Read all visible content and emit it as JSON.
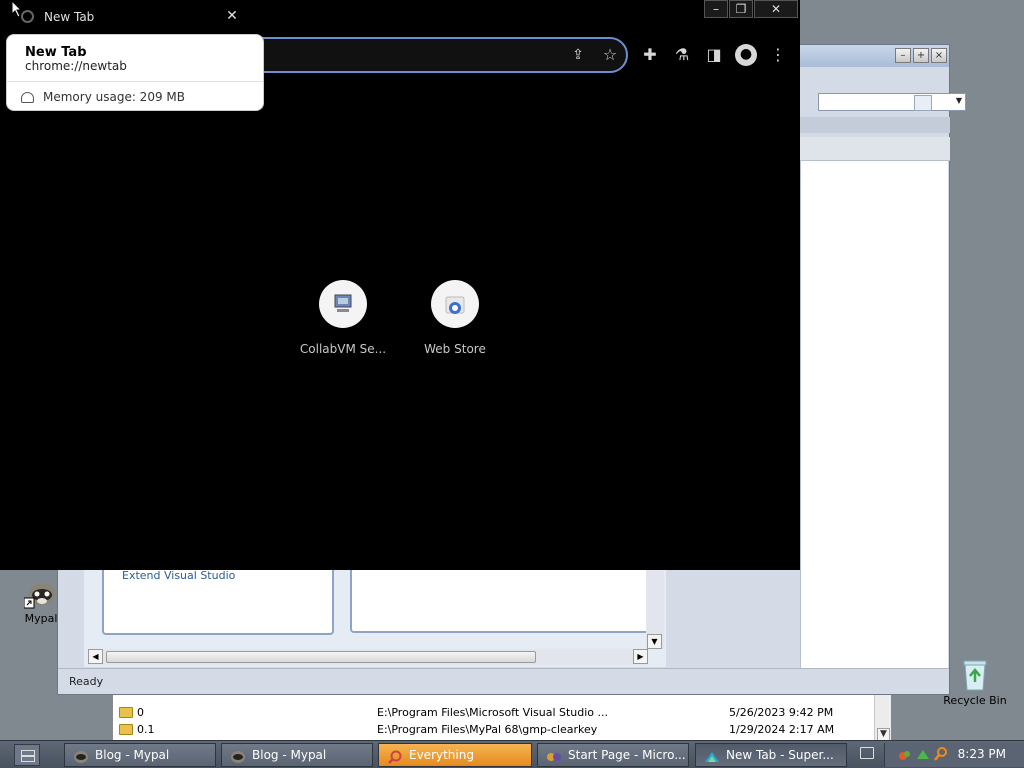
{
  "desktop": {
    "mypal_label": "Mypal",
    "recycle_label": "Recycle Bin"
  },
  "everything_window": {
    "rows": [
      {
        "name": "0",
        "path": "E:\\Program Files\\Microsoft Visual Studio ...",
        "date": "5/26/2023 9:42 PM"
      },
      {
        "name": "0.1",
        "path": "E:\\Program Files\\MyPal 68\\gmp-clearkey",
        "date": "1/29/2024 2:17 AM"
      }
    ]
  },
  "vs_window": {
    "status": "Ready",
    "start_link": "Extend Visual Studio"
  },
  "chrome": {
    "tab_title": "New Tab",
    "tooltip": {
      "title": "New Tab",
      "url": "chrome://newtab",
      "memory": "Memory usage: 209 MB"
    },
    "shortcuts": [
      {
        "label": "CollabVM Se..."
      },
      {
        "label": "Web Store"
      }
    ]
  },
  "taskbar": {
    "tasks": [
      {
        "label": "Blog - Mypal"
      },
      {
        "label": "Blog - Mypal"
      },
      {
        "label": "Everything"
      },
      {
        "label": "Start Page - Micro..."
      },
      {
        "label": "New Tab - Super..."
      }
    ],
    "clock": "8:23 PM"
  },
  "colors": {
    "desktop_bg": "#808890",
    "chrome_bg": "#000000",
    "omnibox_focus": "#6d8fd0",
    "everything_task": "#f0a030"
  }
}
